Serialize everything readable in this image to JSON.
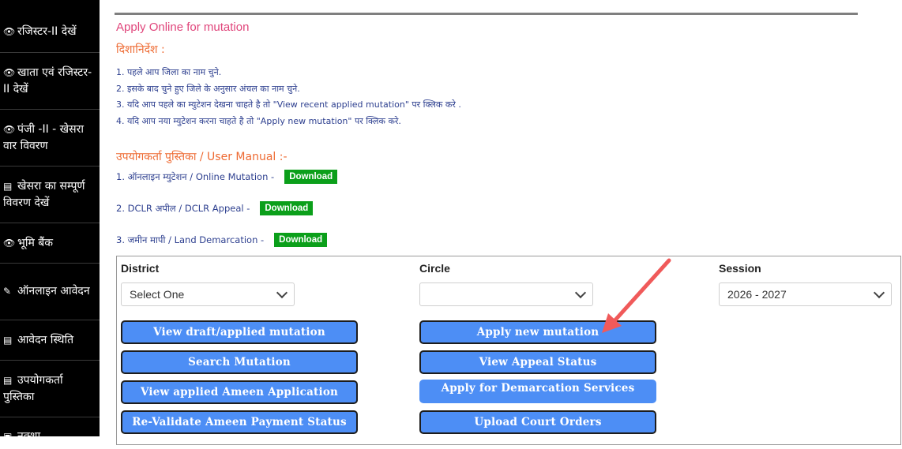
{
  "sidebar": {
    "items": [
      {
        "icon": "eye-icon",
        "glyph": "👁",
        "label": "रजिस्टर-II देखें"
      },
      {
        "icon": "eye-icon",
        "glyph": "👁",
        "label": "खाता एवं रजिस्टर-II देखें"
      },
      {
        "icon": "eye-icon",
        "glyph": "👁",
        "label": "पंजी -II - खेसरा वार विवरण"
      },
      {
        "icon": "list-icon",
        "glyph": "▤",
        "label": "खेसरा का सम्पूर्ण विवरण देखें"
      },
      {
        "icon": "eye-icon",
        "glyph": "👁",
        "label": "भूमि बैंक"
      },
      {
        "icon": "edit-icon",
        "glyph": "✎",
        "label": "ऑनलाइन आवेदन"
      },
      {
        "icon": "list-icon",
        "glyph": "▤",
        "label": "आवेदन स्थिति"
      },
      {
        "icon": "list-icon",
        "glyph": "▤",
        "label": "उपयोगकर्ता पुस्तिका"
      },
      {
        "icon": "image-icon",
        "glyph": "▣",
        "label": "नक्शा"
      }
    ]
  },
  "page": {
    "title": "Apply Online for mutation",
    "guidelines_heading": "दिशानिर्देश :",
    "guidelines": [
      "1. पहले आप जिला का नाम चुने.",
      "2. इसके बाद चुने हुए जिले के अनुसार अंचल का नाम चुने.",
      "3. यदि आप पहले का म्युटेशन देखना चाहते है तो \"View recent applied mutation\" पर क्लिक करे .",
      "4. यदि आप नया म्युटेशन करना चाहते है तो \"Apply new mutation\" पर क्लिक करे."
    ],
    "manual_heading": "उपयोगकर्ता पुस्तिका / User Manual :-",
    "manuals": [
      {
        "label": "1. ऑनलाइन म्युटेशन / Online Mutation -",
        "button": "Download"
      },
      {
        "label": "2. DCLR अपील / DCLR Appeal -",
        "button": "Download"
      },
      {
        "label": "3. जमीन मापी / Land Demarcation -",
        "button": "Download"
      }
    ]
  },
  "form": {
    "district_label": "District",
    "district_value": "Select One",
    "circle_label": "Circle",
    "circle_value": "",
    "session_label": "Session",
    "session_value": "2026 - 2027",
    "buttons": {
      "view_draft": "View draft/applied mutation",
      "apply_new": "Apply new mutation",
      "search": "Search Mutation",
      "appeal_status": "View Appeal Status",
      "ameen_app": "View applied Ameen Application",
      "demarcation": "Apply for Demarcation Services",
      "revalidate": "Re-Validate Ameen Payment Status",
      "court_orders": "Upload Court Orders"
    }
  },
  "colors": {
    "title": "#e0457b",
    "heading": "#ee6a32",
    "download": "#0b9f1a",
    "button": "#4d8ef5",
    "arrow": "#f05a5a"
  }
}
